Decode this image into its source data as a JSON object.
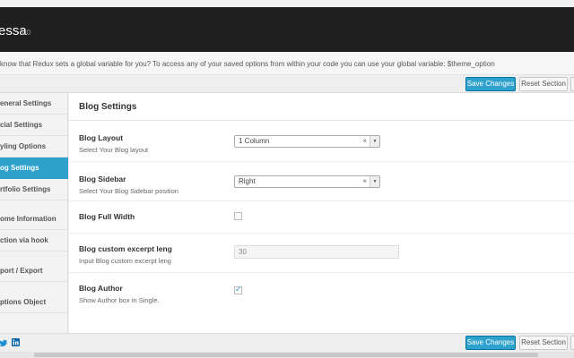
{
  "header": {
    "title": "essa",
    "version": "1.0"
  },
  "notice": "know that Redux sets a global variable for you? To access any of your saved options from within your code you can use your global variable: $theme_option",
  "toolbar": {
    "save_label": "Save Changes",
    "reset_label": "Reset Section"
  },
  "sidebar": {
    "items": [
      {
        "label": "eneral Settings"
      },
      {
        "label": "cial Settings"
      },
      {
        "label": "yling Options"
      },
      {
        "label": "og Settings"
      },
      {
        "label": "rtfolio Settings"
      },
      {
        "label": "ome Information"
      },
      {
        "label": "ction via hook"
      },
      {
        "label": "port / Export"
      },
      {
        "label": "ptions Object"
      }
    ],
    "active_index": 3
  },
  "main": {
    "section_title": "Blog Settings",
    "fields": {
      "layout": {
        "label": "Blog Layout",
        "desc": "Select Your Blog layout",
        "value": "1 Column"
      },
      "sidebar": {
        "label": "Blog Sidebar",
        "desc": "Select Your Blog Sidebar position",
        "value": "Right"
      },
      "full_width": {
        "label": "Blog Full Width",
        "checked": false
      },
      "excerpt": {
        "label": "Blog custom excerpt leng",
        "desc": "Input Blog custom excerpt leng",
        "value": "30"
      },
      "author": {
        "label": "Blog Author",
        "desc": "Show Author box in Single.",
        "checked": true
      }
    }
  },
  "footer": {
    "save_label": "Save Changes",
    "reset_label": "Reset Section"
  },
  "icons": {
    "clear": "×",
    "dropdown": "▼",
    "check": "✓",
    "twitter": "twitter-icon",
    "linkedin": "linkedin-icon"
  },
  "colors": {
    "accent": "#2ea2cc",
    "header_bg": "#1f1f1f"
  }
}
